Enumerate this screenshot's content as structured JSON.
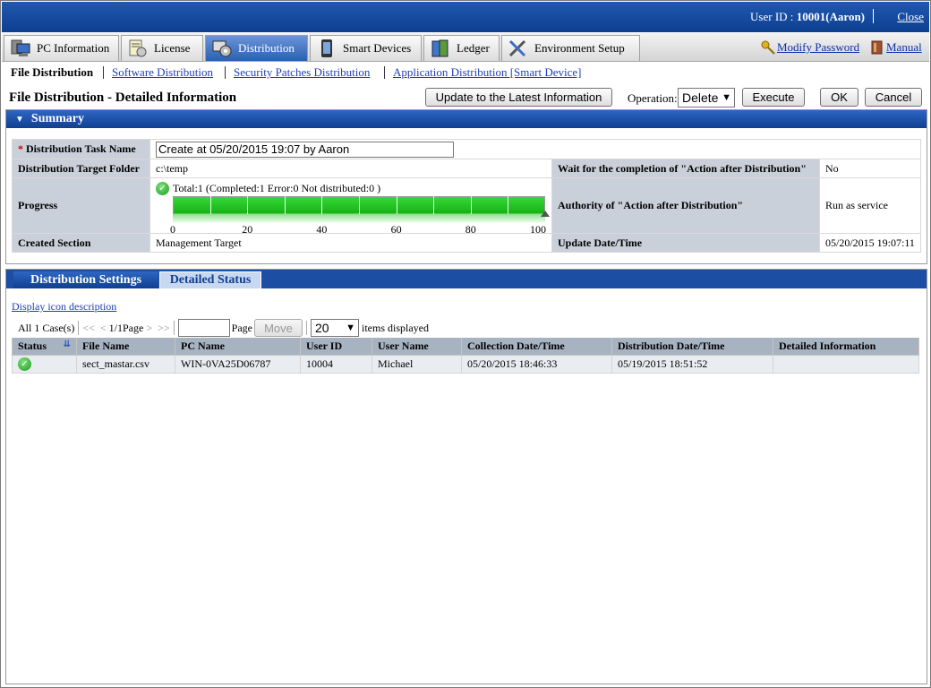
{
  "topbar": {
    "user_prefix": "User ID : ",
    "user_value": "10001(Aaron)",
    "close_label": "Close"
  },
  "nav": {
    "tabs": [
      {
        "label": "PC Information",
        "icon": "pc-icon"
      },
      {
        "label": "License",
        "icon": "license-icon"
      },
      {
        "label": "Distribution",
        "icon": "distribution-icon"
      },
      {
        "label": "Smart Devices",
        "icon": "smartphone-icon"
      },
      {
        "label": "Ledger",
        "icon": "ledger-icon"
      },
      {
        "label": "Environment Setup",
        "icon": "tools-icon"
      }
    ],
    "active_index": 2,
    "modify_password": "Modify Password",
    "manual": "Manual"
  },
  "subnav": {
    "current": "File Distribution",
    "links": [
      "Software Distribution",
      "Security Patches Distribution",
      "Application Distribution [Smart Device]"
    ]
  },
  "header": {
    "title": "File Distribution - Detailed Information",
    "update_button": "Update to the Latest Information",
    "operation_label": "Operation:",
    "operation_value": "Delete",
    "execute_button": "Execute",
    "ok_button": "OK",
    "cancel_button": "Cancel"
  },
  "summary": {
    "heading": "Summary",
    "task_name_label": "Distribution Task Name",
    "task_name_value": "Create at 05/20/2015 19:07 by Aaron",
    "target_folder_label": "Distribution Target Folder",
    "target_folder_value": "c:\\temp",
    "wait_label": "Wait for the completion of \"Action after Distribution\"",
    "wait_value": "No",
    "progress_label": "Progress",
    "progress_text": "Total:1  (Completed:1  Error:0  Not distributed:0 )",
    "progress_percent": 100,
    "progress_ticks": [
      "0",
      "20",
      "40",
      "60",
      "80",
      "100"
    ],
    "authority_label": "Authority of \"Action after Distribution\"",
    "authority_value": "Run as service",
    "created_section_label": "Created Section",
    "created_section_value": "Management Target",
    "update_datetime_label": "Update Date/Time",
    "update_datetime_value": "05/20/2015 19:07:11"
  },
  "details": {
    "tabs": [
      "Distribution Settings",
      "Detailed Status"
    ],
    "active_tab": 1,
    "icon_description_link": "Display icon description",
    "pager": {
      "count_text": "All 1 Case(s)",
      "first": "<<",
      "prev": "<",
      "page_text": "1/1Page",
      "next": ">",
      "last": ">>",
      "page_label": "Page",
      "move_button": "Move",
      "items_per_page": "20",
      "items_label": "items displayed"
    },
    "columns": [
      "Status",
      "File Name",
      "PC Name",
      "User ID",
      "User Name",
      "Collection Date/Time",
      "Distribution Date/Time",
      "Detailed Information"
    ],
    "rows": [
      {
        "status": "completed",
        "file_name": "sect_mastar.csv",
        "pc_name": "WIN-0VA25D06787",
        "user_id": "10004",
        "user_name": "Michael",
        "collection": "05/20/2015 18:46:33",
        "distribution": "05/19/2015 18:51:52",
        "detail": ""
      }
    ]
  },
  "colors": {
    "header_blue": "#1c4ea4",
    "progress_green": "#22c422",
    "link_blue": "#1f3fb8"
  }
}
